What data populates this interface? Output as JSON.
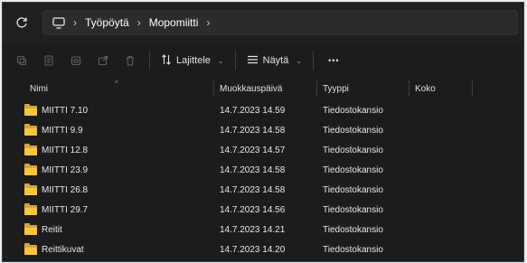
{
  "breadcrumb": [
    "Työpöytä",
    "Mopomiitti"
  ],
  "toolbar": {
    "sort_label": "Lajittele",
    "view_label": "Näytä",
    "more_label": "•••"
  },
  "columns": {
    "name": "Nimi",
    "modified": "Muokkauspäivä",
    "type": "Tyyppi",
    "size": "Koko"
  },
  "files": [
    {
      "name": "MIITTI 7.10",
      "modified": "14.7.2023 14.59",
      "type": "Tiedostokansio",
      "size": ""
    },
    {
      "name": "MIITTI 9.9",
      "modified": "14.7.2023 14.58",
      "type": "Tiedostokansio",
      "size": ""
    },
    {
      "name": "MIITTI 12.8",
      "modified": "14.7.2023 14.57",
      "type": "Tiedostokansio",
      "size": ""
    },
    {
      "name": "MIITTI 23.9",
      "modified": "14.7.2023 14.58",
      "type": "Tiedostokansio",
      "size": ""
    },
    {
      "name": "MIITTI 26.8",
      "modified": "14.7.2023 14.58",
      "type": "Tiedostokansio",
      "size": ""
    },
    {
      "name": "MIITTI 29.7",
      "modified": "14.7.2023 14.56",
      "type": "Tiedostokansio",
      "size": ""
    },
    {
      "name": "Reitit",
      "modified": "14.7.2023 14.21",
      "type": "Tiedostokansio",
      "size": ""
    },
    {
      "name": "Reittikuvat",
      "modified": "14.7.2023 14.20",
      "type": "Tiedostokansio",
      "size": ""
    }
  ],
  "colors": {
    "background": "#1c1c1c",
    "folder": "#f5c642"
  },
  "icons": {
    "refresh": "refresh-icon",
    "location": "this-pc-icon",
    "cut": "cut-icon",
    "copy": "copy-icon",
    "paste": "paste-icon",
    "share": "share-icon",
    "delete": "delete-icon",
    "sort": "sort-icon",
    "view": "view-icon",
    "more": "more-icon",
    "folder": "folder-icon"
  }
}
